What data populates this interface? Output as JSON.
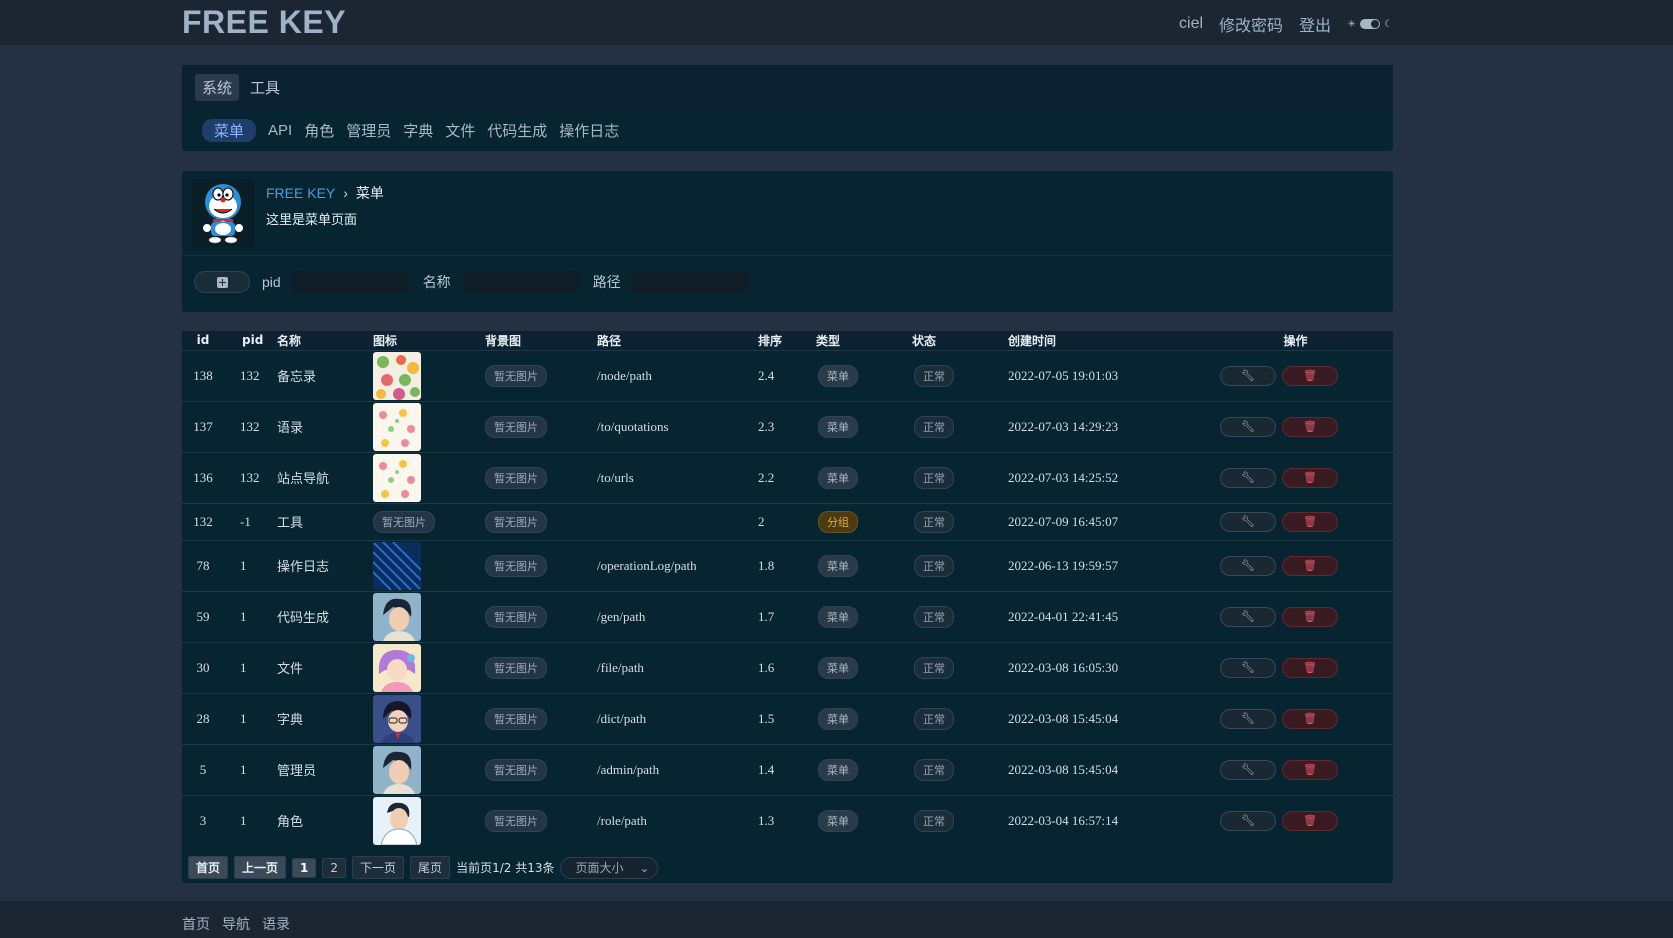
{
  "brand": "FREE KEY",
  "user": {
    "name": "ciel",
    "change_password": "修改密码",
    "logout": "登出"
  },
  "tabs": [
    {
      "label": "系统",
      "active": true
    },
    {
      "label": "工具",
      "active": false
    }
  ],
  "subtabs": [
    {
      "label": "菜单",
      "active": true
    },
    {
      "label": "API"
    },
    {
      "label": "角色"
    },
    {
      "label": "管理员"
    },
    {
      "label": "字典"
    },
    {
      "label": "文件"
    },
    {
      "label": "代码生成"
    },
    {
      "label": "操作日志"
    }
  ],
  "page": {
    "breadcrumb_home": "FREE KEY",
    "breadcrumb_sep": "›",
    "breadcrumb_current": "菜单",
    "description": "这里是菜单页面"
  },
  "filters": {
    "pid_label": "pid",
    "name_label": "名称",
    "path_label": "路径"
  },
  "table": {
    "headers": [
      "id",
      "pid",
      "名称",
      "图标",
      "背景图",
      "路径",
      "排序",
      "类型",
      "状态",
      "创建时间",
      "操作"
    ],
    "no_image": "暂无图片",
    "rows": [
      {
        "id": "138",
        "pid": "132",
        "name": "备忘录",
        "icon": "fruit",
        "path": "/node/path",
        "sort": "2.4",
        "type": "菜单",
        "status": "正常",
        "created": "2022-07-05 19:01:03"
      },
      {
        "id": "137",
        "pid": "132",
        "name": "语录",
        "icon": "flower",
        "path": "/to/quotations",
        "sort": "2.3",
        "type": "菜单",
        "status": "正常",
        "created": "2022-07-03 14:29:23"
      },
      {
        "id": "136",
        "pid": "132",
        "name": "站点导航",
        "icon": "flower",
        "path": "/to/urls",
        "sort": "2.2",
        "type": "菜单",
        "status": "正常",
        "created": "2022-07-03 14:25:52"
      },
      {
        "id": "132",
        "pid": "-1",
        "name": "工具",
        "icon": "",
        "path": "",
        "sort": "2",
        "type": "分组",
        "status": "正常",
        "created": "2022-07-09 16:45:07"
      },
      {
        "id": "78",
        "pid": "1",
        "name": "操作日志",
        "icon": "blue-lines",
        "path": "/operationLog/path",
        "sort": "1.8",
        "type": "菜单",
        "status": "正常",
        "created": "2022-06-13 19:59:57"
      },
      {
        "id": "59",
        "pid": "1",
        "name": "代码生成",
        "icon": "anime-boy",
        "path": "/gen/path",
        "sort": "1.7",
        "type": "菜单",
        "status": "正常",
        "created": "2022-04-01 22:41:45"
      },
      {
        "id": "30",
        "pid": "1",
        "name": "文件",
        "icon": "anime-girl",
        "path": "/file/path",
        "sort": "1.6",
        "type": "菜单",
        "status": "正常",
        "created": "2022-03-08 16:05:30"
      },
      {
        "id": "28",
        "pid": "1",
        "name": "字典",
        "icon": "anime-detective",
        "path": "/dict/path",
        "sort": "1.5",
        "type": "菜单",
        "status": "正常",
        "created": "2022-03-08 15:45:04"
      },
      {
        "id": "5",
        "pid": "1",
        "name": "管理员",
        "icon": "anime-boy",
        "path": "/admin/path",
        "sort": "1.4",
        "type": "菜单",
        "status": "正常",
        "created": "2022-03-08 15:45:04"
      },
      {
        "id": "3",
        "pid": "1",
        "name": "角色",
        "icon": "anime-boy2",
        "path": "/role/path",
        "sort": "1.3",
        "type": "菜单",
        "status": "正常",
        "created": "2022-03-04 16:57:14"
      }
    ]
  },
  "pager": {
    "first": "首页",
    "prev": "上一页",
    "pages": [
      "1",
      "2"
    ],
    "next": "下一页",
    "last": "尾页",
    "info": "当前页1/2 共13条",
    "size_placeholder": "页面大小"
  },
  "footer": {
    "links": [
      "首页",
      "导航",
      "语录"
    ]
  },
  "colors": {
    "accent": "#4d9be0",
    "danger": "#e0596a",
    "group": "#e5a93e"
  }
}
